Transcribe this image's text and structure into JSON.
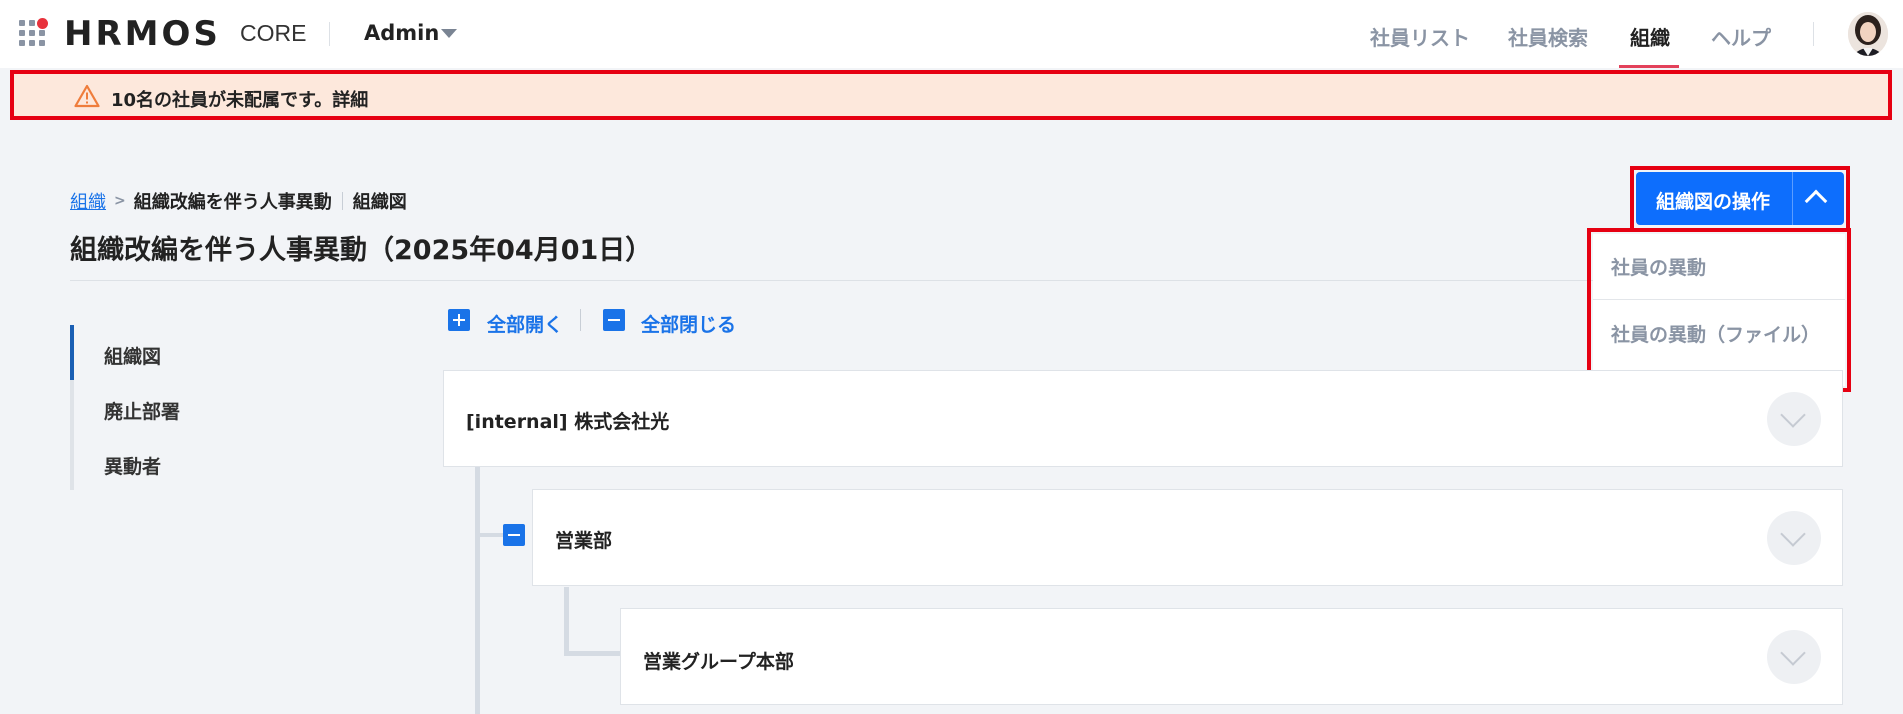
{
  "header": {
    "logo": "HRMOS",
    "logo_sub": "CORE",
    "role": "Admin",
    "nav": [
      "社員リスト",
      "社員検索",
      "組織",
      "ヘルプ"
    ],
    "active_nav": "組織"
  },
  "alert": {
    "text": "10名の社員が未配属です。詳細"
  },
  "breadcrumb": {
    "root": "組織",
    "event": "組織改編を伴う人事異動",
    "current": "組織図"
  },
  "page": {
    "title": "組織改編を伴う人事異動（2025年04月01日）"
  },
  "operation": {
    "button_label": "組織図の操作",
    "menu": [
      "社員の異動",
      "社員の異動（ファイル）"
    ]
  },
  "sidenav": {
    "items": [
      "組織図",
      "廃止部署",
      "異動者"
    ]
  },
  "tree_controls": {
    "expand_all": "全部開く",
    "collapse_all": "全部閉じる"
  },
  "tree": {
    "nodes": [
      "[internal] 株式会社光",
      "営業部",
      "営業グループ本部"
    ]
  },
  "colors": {
    "primary": "#0d6efd",
    "link": "#1a73e8",
    "alert_bg": "#fde8dc",
    "highlight_border": "#e60012",
    "nav_underline": "#e3415a"
  }
}
